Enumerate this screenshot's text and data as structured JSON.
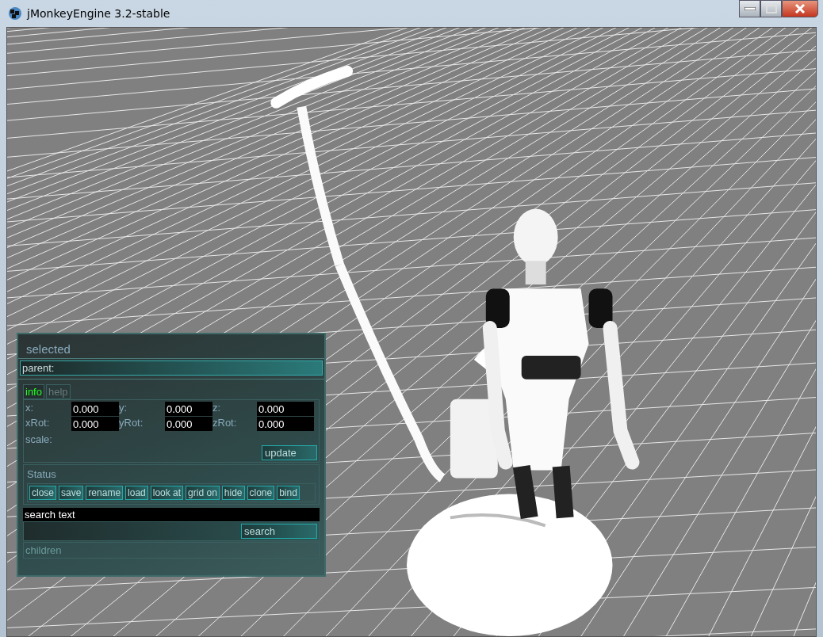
{
  "window": {
    "title": "jMonkeyEngine 3.2-stable"
  },
  "panel": {
    "title": "selected",
    "parent_label": "parent:",
    "tabs": [
      {
        "label": "info",
        "selected": true
      },
      {
        "label": "help",
        "selected": false
      }
    ],
    "fields": [
      {
        "label": "x:",
        "value": "0.000"
      },
      {
        "label": "y:",
        "value": "0.000"
      },
      {
        "label": "z:",
        "value": "0.000"
      },
      {
        "label": "xRot:",
        "value": "0.000"
      },
      {
        "label": "yRot:",
        "value": "0.000"
      },
      {
        "label": "zRot:",
        "value": "0.000"
      }
    ],
    "scale_label": "scale:",
    "update_button": "update",
    "status_label": "Status",
    "actions": [
      "close",
      "save",
      "rename",
      "load",
      "look at",
      "grid on",
      "hide",
      "clone",
      "bind"
    ],
    "search_field": {
      "value": "search text"
    },
    "search_button": "search",
    "children_label": "children"
  }
}
